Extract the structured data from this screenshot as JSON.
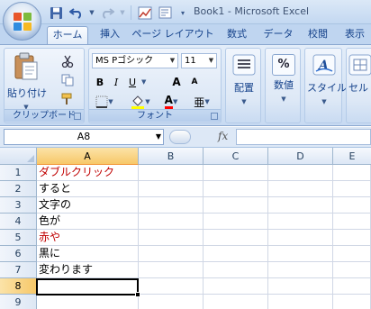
{
  "window": {
    "title": "Book1 - Microsoft Excel"
  },
  "quick_access": [
    "save-icon",
    "undo-icon",
    "redo-icon",
    "chart-icon",
    "form-icon",
    "customize-dropdown-icon"
  ],
  "tabs": [
    {
      "label": "ホーム",
      "active": true
    },
    {
      "label": "挿入"
    },
    {
      "label": "ページ レイアウト"
    },
    {
      "label": "数式"
    },
    {
      "label": "データ"
    },
    {
      "label": "校閲"
    },
    {
      "label": "表示"
    }
  ],
  "ribbon": {
    "clipboard": {
      "paste_label": "貼り付け",
      "group_label": "クリップボード"
    },
    "font": {
      "font_name": "MS Pゴシック",
      "font_size": "11",
      "bold": "B",
      "italic": "I",
      "underline": "U",
      "grow": "A",
      "shrink": "A",
      "font_color_letter": "A",
      "phonetic": "亜",
      "group_label": "フォント",
      "font_color": "#ff0000",
      "fill_color": "#ffff00"
    },
    "alignment_label": "配置",
    "number_label": "数値",
    "number_symbol": "%",
    "style_label": "スタイル",
    "cells_label": "セル"
  },
  "formula_bar": {
    "name_box": "A8",
    "fx_label": "fx",
    "formula": ""
  },
  "sheet": {
    "columns": [
      "A",
      "B",
      "C",
      "D",
      "E"
    ],
    "selected_column": "A",
    "rows": [
      {
        "num": "1",
        "a": "ダブルクリック",
        "color": "red"
      },
      {
        "num": "2",
        "a": "すると",
        "color": "black"
      },
      {
        "num": "3",
        "a": "文字の",
        "color": "black"
      },
      {
        "num": "4",
        "a": "色が",
        "color": "black"
      },
      {
        "num": "5",
        "a": "赤や",
        "color": "red"
      },
      {
        "num": "6",
        "a": "黒に",
        "color": "black"
      },
      {
        "num": "7",
        "a": "変わります",
        "color": "black"
      },
      {
        "num": "8",
        "a": "",
        "color": "black"
      },
      {
        "num": "9",
        "a": "",
        "color": "black"
      }
    ],
    "selected_row": "8",
    "active_cell": "A8"
  }
}
